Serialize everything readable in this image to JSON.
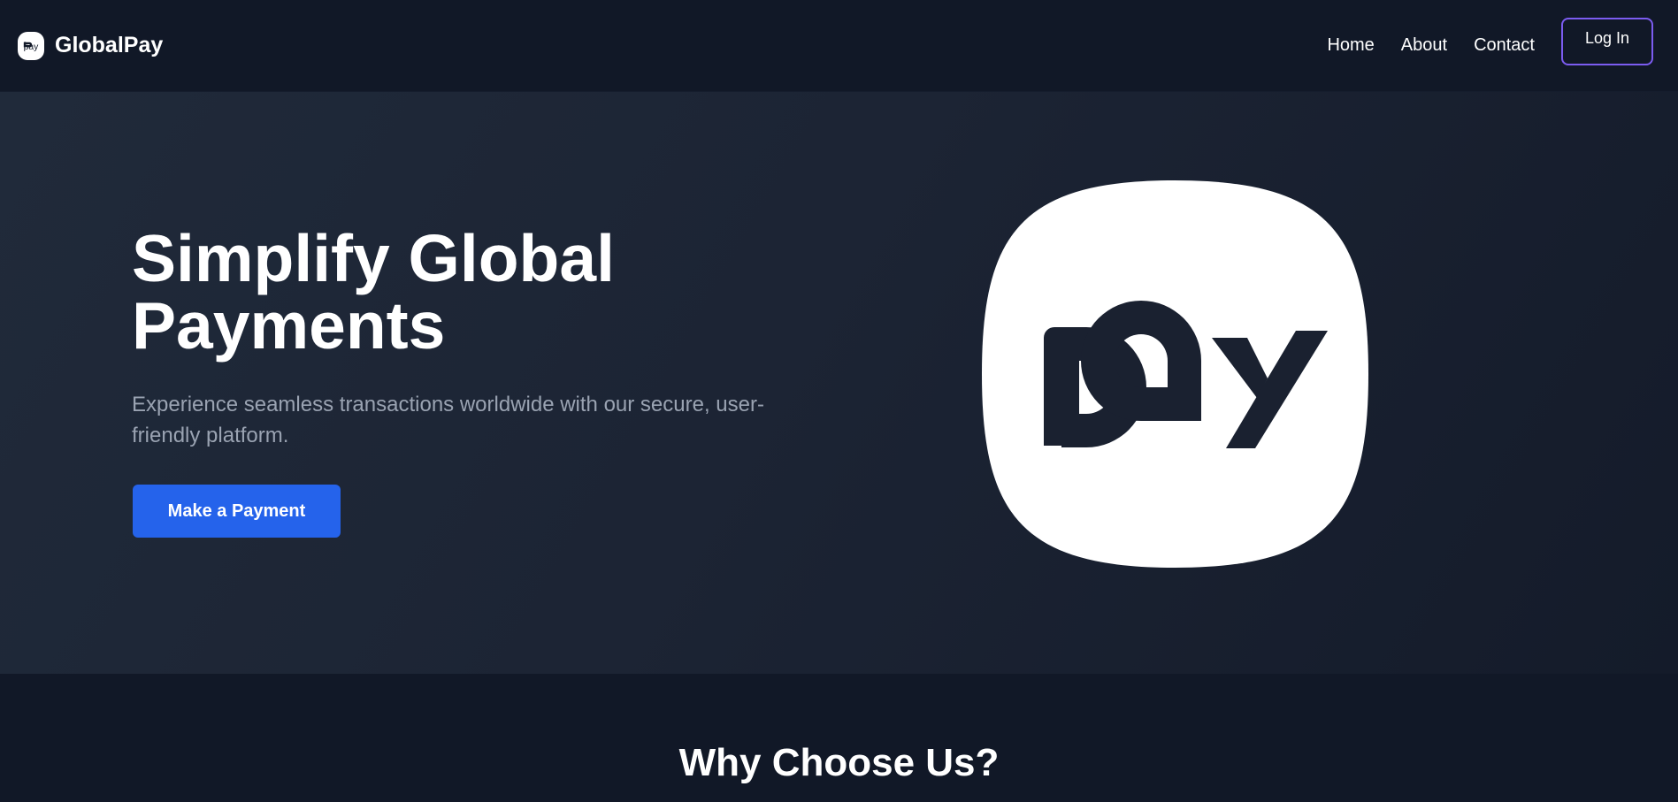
{
  "brand": {
    "name": "GlobalPay",
    "logo_icon": "pay-logo-icon"
  },
  "nav": {
    "links": [
      {
        "label": "Home"
      },
      {
        "label": "About"
      },
      {
        "label": "Contact"
      }
    ],
    "login_label": "Log In"
  },
  "hero": {
    "title_line1": "Simplify Global",
    "title_line2": "Payments",
    "subtitle": "Experience seamless transactions worldwide with our secure, user-friendly platform.",
    "cta_label": "Make a Payment",
    "logo_icon": "pay-logo-icon"
  },
  "features": {
    "title": "Why Choose Us?"
  },
  "colors": {
    "background": "#111827",
    "primary": "#2563eb",
    "login_border": "#7c5cf0",
    "subtitle": "#9aa3b2"
  }
}
